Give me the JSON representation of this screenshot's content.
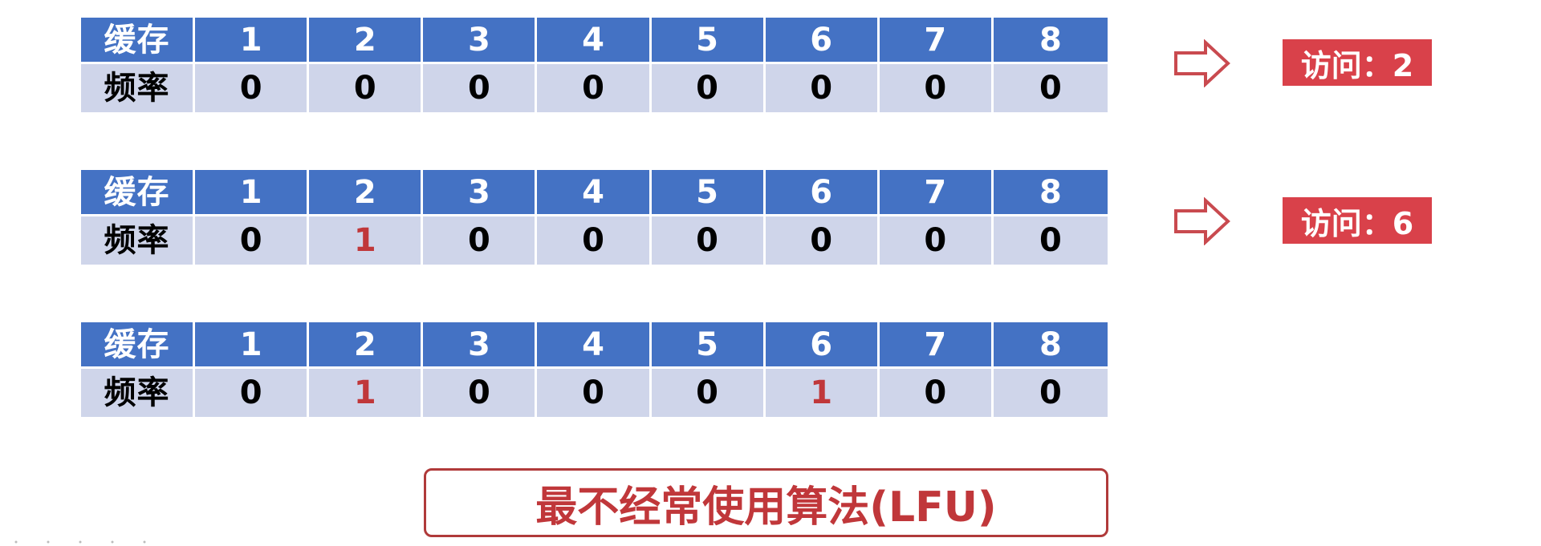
{
  "tables": [
    {
      "header_label": "缓存",
      "freq_label": "频率",
      "keys": [
        "1",
        "2",
        "3",
        "4",
        "5",
        "6",
        "7",
        "8"
      ],
      "freqs": [
        "0",
        "0",
        "0",
        "0",
        "0",
        "0",
        "0",
        "0"
      ],
      "hits": []
    },
    {
      "header_label": "缓存",
      "freq_label": "频率",
      "keys": [
        "1",
        "2",
        "3",
        "4",
        "5",
        "6",
        "7",
        "8"
      ],
      "freqs": [
        "0",
        "1",
        "0",
        "0",
        "0",
        "0",
        "0",
        "0"
      ],
      "hits": [
        1
      ]
    },
    {
      "header_label": "缓存",
      "freq_label": "频率",
      "keys": [
        "1",
        "2",
        "3",
        "4",
        "5",
        "6",
        "7",
        "8"
      ],
      "freqs": [
        "0",
        "1",
        "0",
        "0",
        "0",
        "1",
        "0",
        "0"
      ],
      "hits": [
        1,
        5
      ]
    }
  ],
  "access_steps": [
    {
      "label": "访问：2"
    },
    {
      "label": "访问：6"
    }
  ],
  "title": "最不经常使用算法(LFU)",
  "colors": {
    "header_bg": "#4472c4",
    "freq_bg": "#cfd5ea",
    "accent_red": "#c0373a",
    "badge_red": "#d9414a"
  },
  "icons": {
    "arrow": "right-arrow-outline-icon"
  }
}
